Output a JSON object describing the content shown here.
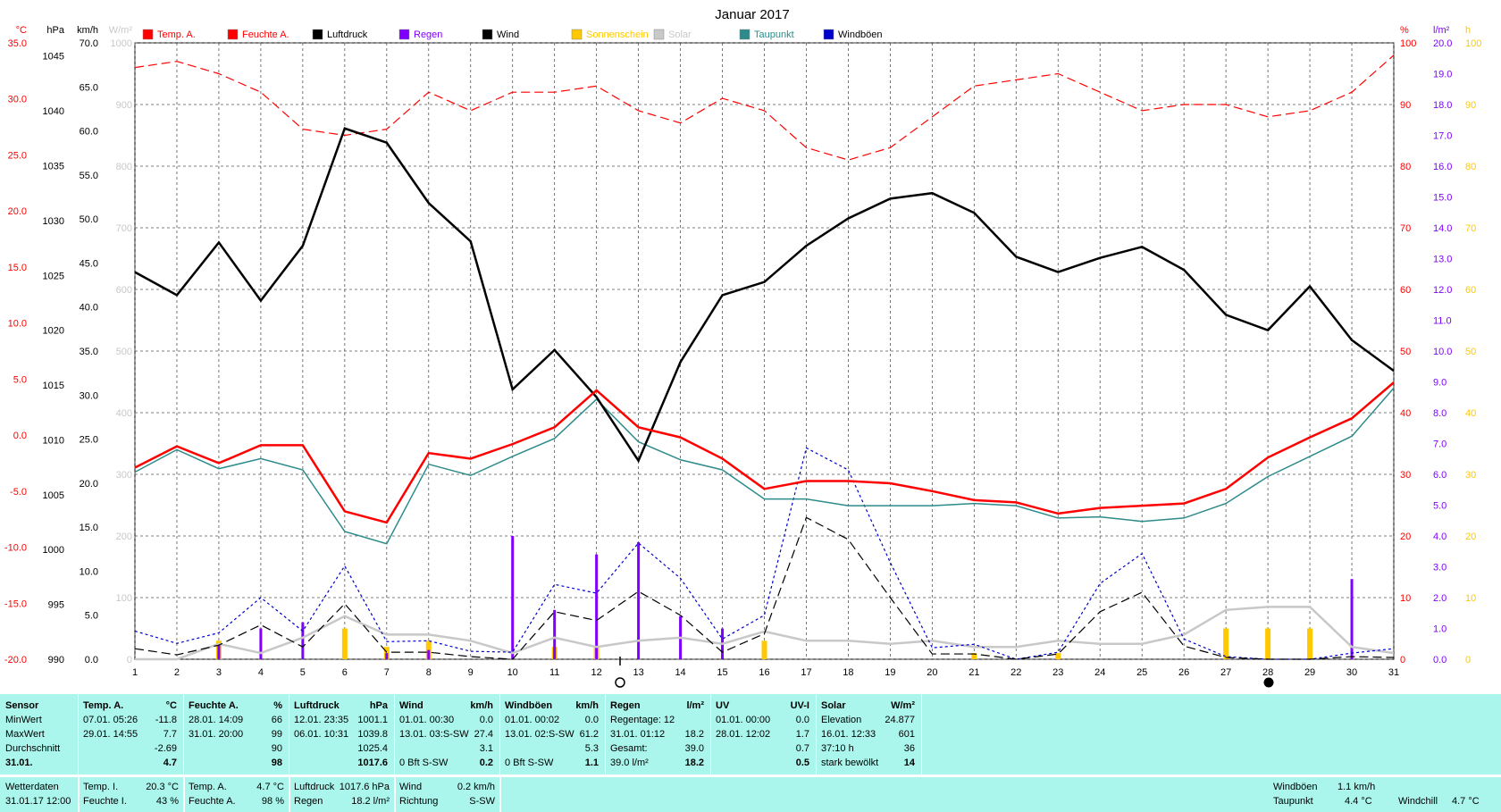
{
  "chart_data": {
    "type": "line",
    "title": "Januar 2017",
    "x": [
      1,
      2,
      3,
      4,
      5,
      6,
      7,
      8,
      9,
      10,
      11,
      12,
      13,
      14,
      15,
      16,
      17,
      18,
      19,
      20,
      21,
      22,
      23,
      24,
      25,
      26,
      27,
      28,
      29,
      30,
      31
    ],
    "axes": {
      "temp": {
        "unit": "°C",
        "range": [
          -20,
          35
        ],
        "ticks": [
          "35.0",
          "30.0",
          "25.0",
          "20.0",
          "15.0",
          "10.0",
          "5.0",
          "0.0",
          "-5.0",
          "-10.0",
          "-15.0",
          "-20.0"
        ]
      },
      "pressure": {
        "unit": "hPa",
        "range": [
          990,
          1046.2
        ],
        "ticks": [
          "1045",
          "1040",
          "1035",
          "1030",
          "1025",
          "1020",
          "1015",
          "1010",
          "1005",
          "1000",
          "995",
          "990"
        ]
      },
      "wind": {
        "unit": "km/h",
        "range": [
          0,
          70
        ],
        "ticks": [
          "70.0",
          "65.0",
          "60.0",
          "55.0",
          "50.0",
          "45.0",
          "40.0",
          "35.0",
          "30.0",
          "25.0",
          "20.0",
          "15.0",
          "10.0",
          "5.0",
          "0.0"
        ]
      },
      "solar": {
        "unit": "W/m²",
        "range": [
          0,
          1000
        ],
        "ticks": [
          "1000",
          "900",
          "800",
          "700",
          "600",
          "500",
          "400",
          "300",
          "200",
          "100",
          "0"
        ]
      },
      "humidity": {
        "unit": "%",
        "range": [
          0,
          100
        ],
        "ticks": [
          "100",
          "90",
          "80",
          "70",
          "60",
          "50",
          "40",
          "30",
          "20",
          "10",
          "0"
        ]
      },
      "rain": {
        "unit": "l/m²",
        "range": [
          0,
          20
        ],
        "ticks": [
          "20.0",
          "19.0",
          "18.0",
          "17.0",
          "16.0",
          "15.0",
          "14.0",
          "13.0",
          "12.0",
          "11.0",
          "10.0",
          "9.0",
          "8.0",
          "7.0",
          "6.0",
          "5.0",
          "4.0",
          "3.0",
          "2.0",
          "1.0",
          "0.0"
        ]
      },
      "sunshine": {
        "unit": "h",
        "range": [
          0,
          100
        ],
        "ticks": [
          "100",
          "90",
          "80",
          "70",
          "60",
          "50",
          "40",
          "30",
          "20",
          "10",
          "0"
        ]
      }
    },
    "legend": [
      "Temp. A.",
      "Feuchte A.",
      "Luftdruck",
      "Regen",
      "Wind",
      "Sonnenschein",
      "Solar",
      "Taupunkt",
      "Windböen"
    ],
    "colors": {
      "temp": "#ff0000",
      "humidity": "#ff0000",
      "pressure": "#000000",
      "rain": "#8000ff",
      "wind": "#000000",
      "sunshine": "#ffc800",
      "solar": "#c8c8c8",
      "dewpoint": "#2e8b8b",
      "gusts": "#0000cc"
    },
    "series": [
      {
        "name": "Temp. A.",
        "values": [
          -2.9,
          -1.0,
          -2.5,
          -0.9,
          -0.9,
          -6.8,
          -7.8,
          -1.6,
          -2.1,
          -0.8,
          0.7,
          4.0,
          0.7,
          -0.2,
          -2.1,
          -4.8,
          -4.1,
          -4.1,
          -4.3,
          -5.0,
          -5.8,
          -6.0,
          -7.0,
          -6.5,
          -6.3,
          -6.1,
          -4.8,
          -2.0,
          -0.2,
          1.5,
          4.7
        ]
      },
      {
        "name": "Feuchte A.",
        "values": [
          96,
          97,
          95,
          92,
          86,
          85,
          86,
          92,
          89,
          92,
          92,
          93,
          89,
          87,
          91,
          89,
          83,
          81,
          83,
          88,
          93,
          94,
          95,
          92,
          89,
          90,
          90,
          88,
          89,
          92,
          98
        ]
      },
      {
        "name": "Luftdruck",
        "values": [
          1025.3,
          1023.2,
          1028.0,
          1022.7,
          1027.7,
          1038.4,
          1037.1,
          1031.6,
          1028.1,
          1014.6,
          1018.2,
          1013.9,
          1008.1,
          1017.1,
          1023.2,
          1024.4,
          1027.7,
          1030.2,
          1032.0,
          1032.5,
          1030.7,
          1026.7,
          1025.3,
          1026.6,
          1027.6,
          1025.5,
          1021.4,
          1020.0,
          1024.0,
          1019.1,
          1016.3
        ]
      },
      {
        "name": "Regen",
        "values": [
          0.0,
          0.0,
          0.5,
          1.0,
          1.2,
          0.0,
          0.2,
          0.3,
          0.0,
          4.0,
          1.6,
          3.4,
          3.8,
          1.4,
          1.0,
          0.0,
          0.0,
          0.0,
          0.0,
          0.0,
          0.0,
          0.0,
          0.0,
          0.0,
          0.0,
          0.0,
          0.0,
          0.0,
          0.0,
          2.6,
          0.0
        ]
      },
      {
        "name": "Wind",
        "values": [
          1.2,
          0.5,
          1.6,
          3.9,
          1.4,
          6.3,
          0.8,
          0.8,
          0.3,
          0.0,
          5.4,
          4.4,
          7.7,
          5.0,
          0.8,
          2.9,
          16.1,
          13.6,
          7.0,
          0.6,
          0.6,
          0.0,
          0.6,
          5.4,
          7.6,
          1.5,
          0.2,
          0.0,
          0.0,
          0.3,
          0.2
        ]
      },
      {
        "name": "Sonnenschein",
        "values": [
          0,
          0,
          3,
          0,
          0,
          5,
          2,
          3,
          0,
          0,
          2,
          2,
          0,
          0,
          0,
          3,
          0,
          0,
          0,
          0,
          1,
          0,
          1,
          0,
          0,
          0,
          5,
          5,
          5,
          0,
          0
        ]
      },
      {
        "name": "Solar",
        "values": [
          0,
          0,
          25,
          10,
          35,
          70,
          40,
          40,
          30,
          10,
          35,
          20,
          30,
          35,
          25,
          45,
          30,
          30,
          25,
          30,
          20,
          20,
          30,
          25,
          25,
          40,
          80,
          85,
          85,
          20,
          10
        ]
      },
      {
        "name": "Taupunkt",
        "values": [
          -3.3,
          -1.3,
          -3.0,
          -2.1,
          -3.1,
          -8.6,
          -9.7,
          -2.6,
          -3.6,
          -1.9,
          -0.3,
          3.2,
          -0.6,
          -2.2,
          -3.1,
          -5.7,
          -5.7,
          -6.3,
          -6.3,
          -6.3,
          -6.1,
          -6.3,
          -7.4,
          -7.3,
          -7.7,
          -7.4,
          -6.1,
          -3.7,
          -1.9,
          -0.1,
          4.2
        ]
      },
      {
        "name": "Windböen",
        "values": [
          3.2,
          1.8,
          3.0,
          7.0,
          3.2,
          10.6,
          2.0,
          2.1,
          0.9,
          0.8,
          8.5,
          7.5,
          13.2,
          9.2,
          2.3,
          5.0,
          24.0,
          21.5,
          11.0,
          1.3,
          1.7,
          0.0,
          0.8,
          8.6,
          12.0,
          2.3,
          0.3,
          0.0,
          0.0,
          0.7,
          1.2
        ]
      }
    ],
    "xlim": [
      1,
      31
    ],
    "grid": true,
    "legend_placement": "top"
  },
  "stats": {
    "cols": [
      {
        "header": "Sensor",
        "unit": "",
        "rows": [
          "MinWert",
          "MaxWert",
          "Durchschnitt",
          "31.01."
        ]
      },
      {
        "header": "Temp. A.",
        "unit": "°C",
        "rows": [
          "07.01.  05:26",
          "29.01.  14:55",
          "",
          ""
        ],
        "vals": [
          "-11.8",
          "7.7",
          "-2.69",
          "4.7"
        ]
      },
      {
        "header": "Feuchte A.",
        "unit": "%",
        "rows": [
          "28.01.  14:09",
          "31.01.  20:00",
          "",
          ""
        ],
        "vals": [
          "66",
          "99",
          "90",
          "98"
        ]
      },
      {
        "header": "Luftdruck",
        "unit": "hPa",
        "rows": [
          "12.01.  23:35",
          "06.01.  10:31",
          "",
          ""
        ],
        "vals": [
          "1001.1",
          "1039.8",
          "1025.4",
          "1017.6"
        ]
      },
      {
        "header": "Wind",
        "unit": "km/h",
        "rows": [
          "01.01.  00:30",
          "13.01.  03:S-SW",
          "",
          "0 Bft S-SW"
        ],
        "vals": [
          "0.0",
          "27.4",
          "3.1",
          "0.2"
        ]
      },
      {
        "header": "Windböen",
        "unit": "km/h",
        "rows": [
          "01.01.  00:02",
          "13.01.  02:S-SW",
          "",
          "0 Bft S-SW"
        ],
        "vals": [
          "0.0",
          "61.2",
          "5.3",
          "1.1"
        ]
      },
      {
        "header": "Regen",
        "unit": "l/m²",
        "rows": [
          "Regentage: 12",
          "31.01.  01:12",
          "Gesamt:",
          " 39.0 l/m²"
        ],
        "vals": [
          "",
          "18.2",
          "39.0",
          "18.2"
        ]
      },
      {
        "header": "UV",
        "unit": "UV-I",
        "rows": [
          "01.01.  00:00",
          "28.01.  12:02",
          "",
          ""
        ],
        "vals": [
          "0.0",
          "1.7",
          "0.7",
          "0.5"
        ]
      },
      {
        "header": "Solar",
        "unit": "W/m²",
        "rows": [
          "Elevation",
          "16.01.  12:33",
          "37:10 h",
          "stark bewölkt"
        ],
        "vals": [
          "24.877",
          "601",
          "36",
          "14"
        ]
      }
    ]
  },
  "footer": {
    "l1": "Wetterdaten",
    "l2": "31.01.17 12:00",
    "ti_label": "Temp. I.",
    "ti_val": "20.3 °C",
    "fi_label": "Feuchte I.",
    "fi_val": "43 %",
    "ta_label": "Temp. A.",
    "ta_val": "4.7 °C",
    "fa_label": "Feuchte A.",
    "fa_val": "98 %",
    "lp_label": "Luftdruck",
    "lp_val": "1017.6 hPa",
    "rg_label": "Regen",
    "rg_val": "18.2 l/m²",
    "w_label": "Wind",
    "w_val": "0.2 km/h",
    "r_label": "Richtung",
    "r_val": "S-SW",
    "wb_label": "Windböen",
    "wb_val": "1.1 km/h",
    "tp_label": "Taupunkt",
    "tp_val": "4.4 °C",
    "wc_label": "Windchill",
    "wc_val": "4.7 °C"
  }
}
